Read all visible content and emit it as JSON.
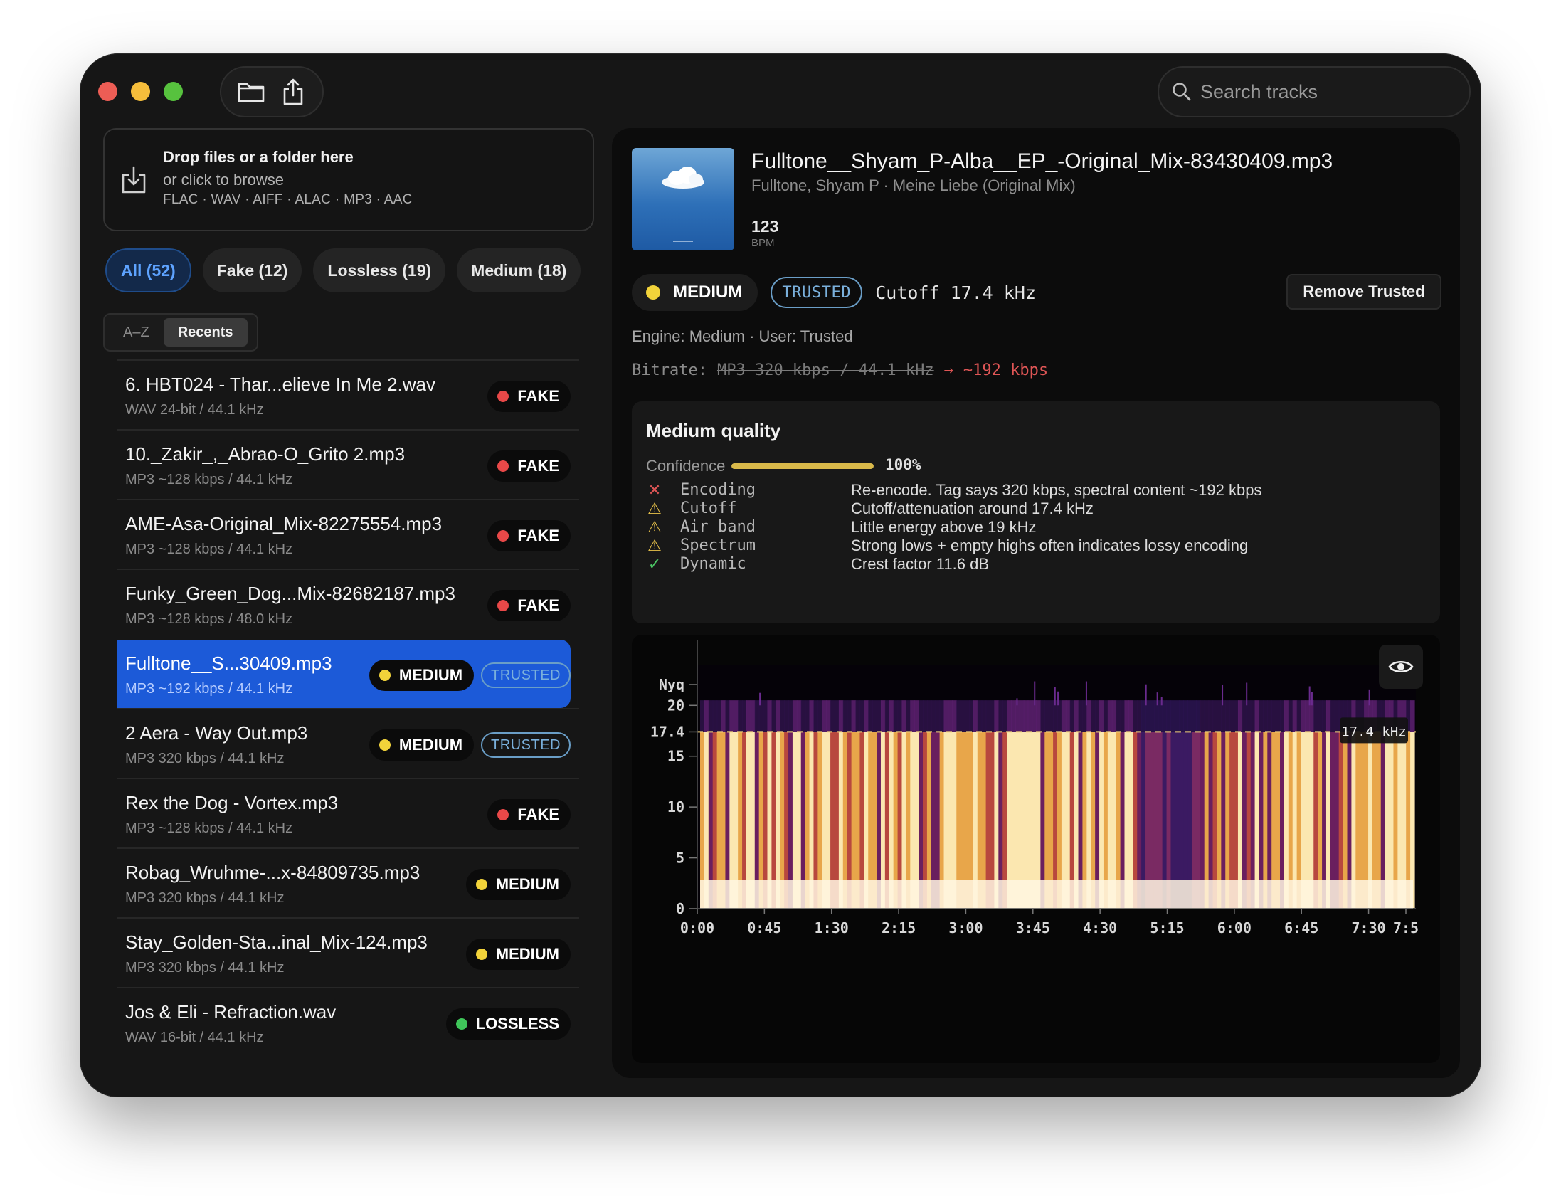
{
  "toolbar": {
    "search_placeholder": "Search tracks"
  },
  "dropzone": {
    "title": "Drop files or a folder here",
    "subtitle": "or click to browse",
    "formats": "FLAC · WAV · AIFF · ALAC · MP3 · AAC"
  },
  "filters": [
    {
      "label": "All (52)",
      "active": true
    },
    {
      "label": "Fake (12)",
      "active": false
    },
    {
      "label": "Lossless (19)",
      "active": false
    },
    {
      "label": "Medium (18)",
      "active": false
    }
  ],
  "sort": {
    "az": "A–Z",
    "recents": "Recents"
  },
  "track_list": {
    "cut_text": "WAV 16-bit / 44.1 kHz",
    "tracks": [
      {
        "name": "6. HBT024 - Thar...elieve In Me 2.wav",
        "meta": "WAV 24-bit / 44.1 kHz",
        "verdict": "FAKE",
        "trusted": null
      },
      {
        "name": "10._Zakir_,_Abrao-O_Grito 2.mp3",
        "meta": "MP3 ~128 kbps / 44.1 kHz",
        "verdict": "FAKE",
        "trusted": null
      },
      {
        "name": "AME-Asa-Original_Mix-82275554.mp3",
        "meta": "MP3 ~128 kbps / 44.1 kHz",
        "verdict": "FAKE",
        "trusted": null
      },
      {
        "name": "Funky_Green_Dog...Mix-82682187.mp3",
        "meta": "MP3 ~128 kbps / 48.0 kHz",
        "verdict": "FAKE",
        "trusted": null
      },
      {
        "name": "Fulltone__S...30409.mp3",
        "meta": "MP3 ~192 kbps / 44.1 kHz",
        "verdict": "MEDIUM",
        "trusted": "TRUSTED",
        "selected": true
      },
      {
        "name": "2 Aera - Way Out.mp3",
        "meta": "MP3 320 kbps / 44.1 kHz",
        "verdict": "MEDIUM",
        "trusted": "TRUSTED"
      },
      {
        "name": "Rex the Dog - Vortex.mp3",
        "meta": "MP3 ~128 kbps / 44.1 kHz",
        "verdict": "FAKE",
        "trusted": null
      },
      {
        "name": "Robag_Wruhme-...x-84809735.mp3",
        "meta": "MP3 320 kbps / 44.1 kHz",
        "verdict": "MEDIUM",
        "trusted": null
      },
      {
        "name": "Stay_Golden-Sta...inal_Mix-124.mp3",
        "meta": "MP3 320 kbps / 44.1 kHz",
        "verdict": "MEDIUM",
        "trusted": null
      },
      {
        "name": "Jos & Eli - Refraction.wav",
        "meta": "WAV 16-bit / 44.1 kHz",
        "verdict": "LOSSLESS",
        "trusted": null
      }
    ]
  },
  "verdict_colors": {
    "FAKE": "#e84848",
    "MEDIUM": "#f2d33a",
    "LOSSLESS": "#3fc65a"
  },
  "detail": {
    "title": "Fulltone__Shyam_P-Alba__EP_-Original_Mix-83430409.mp3",
    "artist": "Fulltone, Shyam P · Meine Liebe (Original Mix)",
    "bpm": "123",
    "bpm_label": "BPM",
    "verdict": "MEDIUM",
    "trusted": "TRUSTED",
    "cutoff": "Cutoff 17.4 kHz",
    "remove_button": "Remove Trusted",
    "engine": "Engine: Medium · User: Trusted",
    "bitrate_label": "Bitrate:",
    "bitrate_claimed": "MP3 320 kbps / 44.1 kHz",
    "bitrate_arrow": "→",
    "bitrate_actual": "~192 kbps"
  },
  "quality": {
    "title": "Medium quality",
    "confidence_label": "Confidence",
    "confidence_value": 1.0,
    "confidence_text": "100%",
    "checks": [
      {
        "status": "fail",
        "icon": "x-icon",
        "label": "Encoding",
        "value": "Re-encode. Tag says 320 kbps, spectral content ~192 kbps"
      },
      {
        "status": "warn",
        "icon": "warning-icon",
        "label": "Cutoff",
        "value": "Cutoff/attenuation around 17.4 kHz"
      },
      {
        "status": "warn",
        "icon": "warning-icon",
        "label": "Air band",
        "value": "Little energy above 19 kHz"
      },
      {
        "status": "warn",
        "icon": "warning-icon",
        "label": "Spectrum",
        "value": "Strong lows + empty highs often indicates lossy encoding"
      },
      {
        "status": "pass",
        "icon": "check-icon",
        "label": "Dynamic",
        "value": "Crest factor 11.6 dB"
      }
    ],
    "status_colors": {
      "fail": "#e05656",
      "warn": "#e8c24a",
      "pass": "#4cc765"
    }
  },
  "chart_data": {
    "type": "heatmap",
    "title": "",
    "xlabel": "",
    "ylabel": "",
    "x_ticks": [
      "0:00",
      "0:45",
      "1:30",
      "2:15",
      "3:00",
      "3:45",
      "4:30",
      "5:15",
      "6:00",
      "6:45",
      "7:30",
      "7:5"
    ],
    "x_tick_seconds": [
      0,
      45,
      90,
      135,
      180,
      225,
      270,
      315,
      360,
      405,
      450,
      475
    ],
    "x_range_seconds": [
      0,
      475
    ],
    "y_ticks": [
      {
        "label": "0",
        "value": 0
      },
      {
        "label": "5",
        "value": 5
      },
      {
        "label": "10",
        "value": 10
      },
      {
        "label": "15",
        "value": 15
      },
      {
        "label": "17.4",
        "value": 17.4
      },
      {
        "label": "20",
        "value": 20
      },
      {
        "label": "Nyq",
        "value": 22.05
      }
    ],
    "y_range_khz": [
      0,
      22.05
    ],
    "cutoff_khz": 17.4,
    "cutoff_label": "17.4 kHz"
  }
}
